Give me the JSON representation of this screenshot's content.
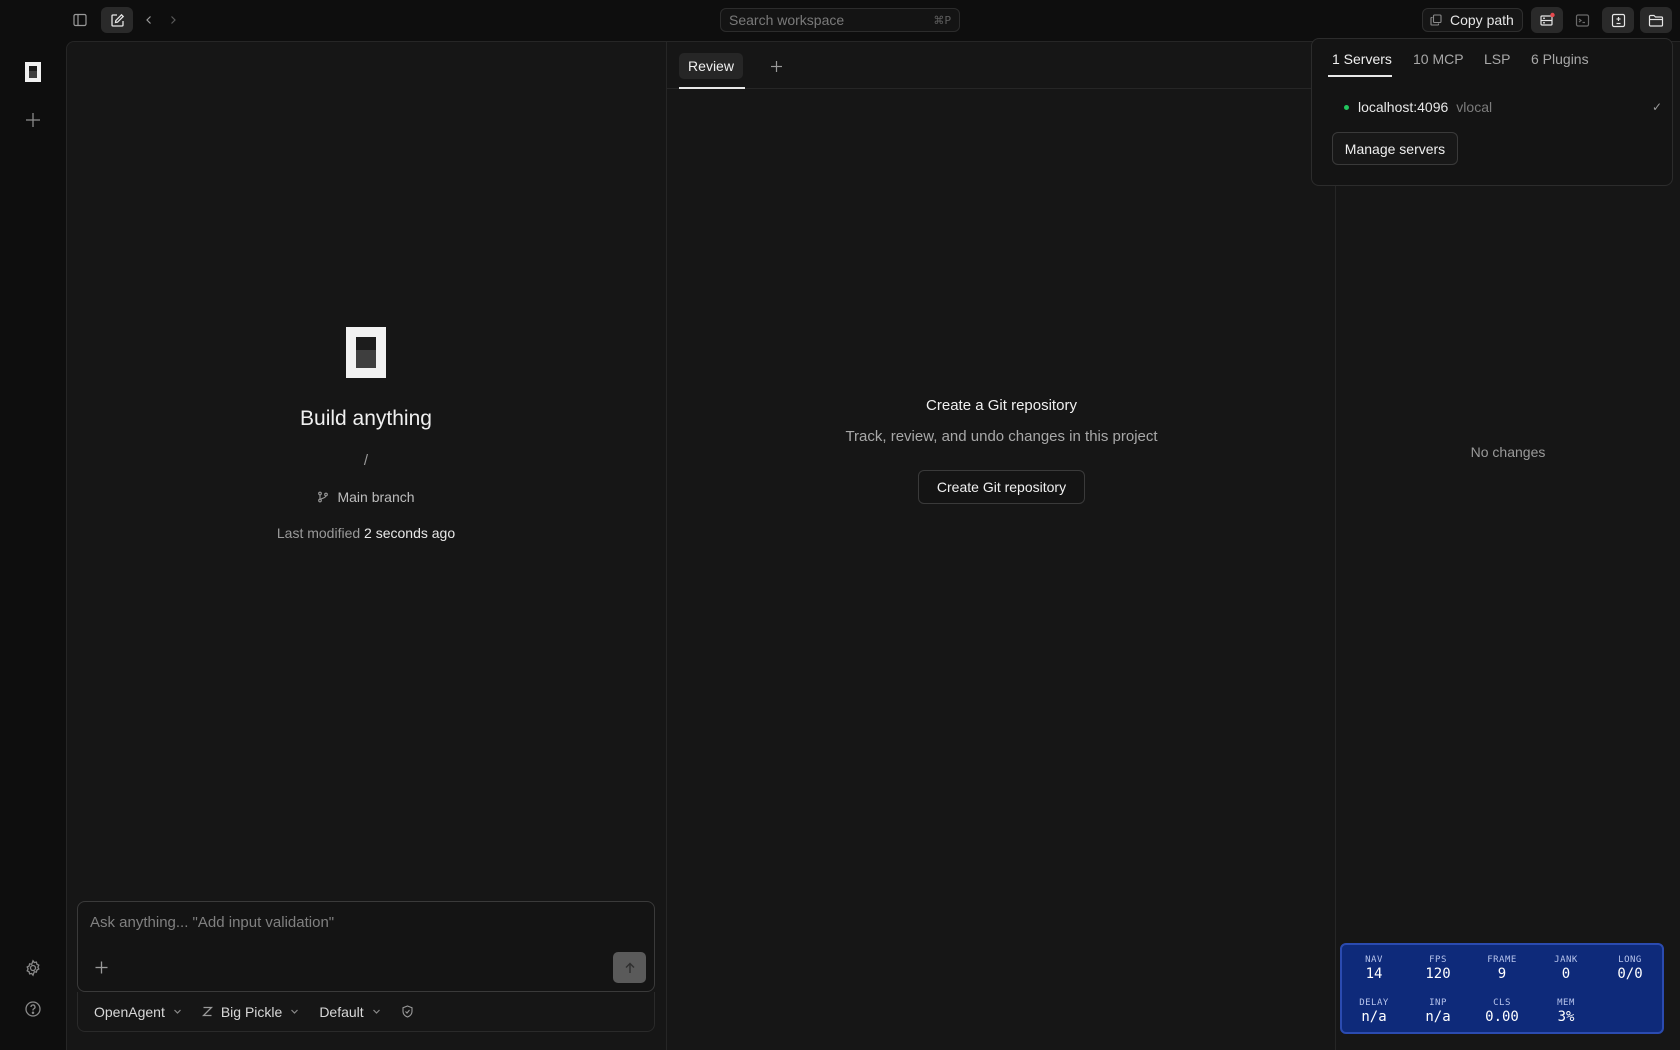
{
  "topbar": {
    "search_placeholder": "Search workspace",
    "search_shortcut": "⌘P",
    "copy_path_label": "Copy path"
  },
  "center": {
    "title": "Build anything",
    "path": "/",
    "branch": "Main branch",
    "modified_prefix": "Last modified",
    "modified_time": "2 seconds ago"
  },
  "prompt": {
    "placeholder": "Ask anything... \"Add input validation\"",
    "agent": "OpenAgent",
    "model": "Big Pickle",
    "variant": "Default"
  },
  "review": {
    "tab_label": "Review",
    "empty_title": "Create a Git repository",
    "empty_subtitle": "Track, review, and undo changes in this project",
    "create_button": "Create Git repository",
    "no_changes": "No changes"
  },
  "popover": {
    "tabs": [
      "1 Servers",
      "10 MCP",
      "LSP",
      "6 Plugins"
    ],
    "server": {
      "name": "localhost:4096",
      "version": "vlocal",
      "check": "✓",
      "status_color": "#22c55e"
    },
    "manage_button": "Manage servers"
  },
  "perf": {
    "metrics": [
      {
        "label": "NAV",
        "value": "14"
      },
      {
        "label": "FPS",
        "value": "120"
      },
      {
        "label": "FRAME",
        "value": "9"
      },
      {
        "label": "JANK",
        "value": "0"
      },
      {
        "label": "LONG",
        "value": "0/0"
      },
      {
        "label": "DELAY",
        "value": "n/a"
      },
      {
        "label": "INP",
        "value": "n/a"
      },
      {
        "label": "CLS",
        "value": "0.00"
      },
      {
        "label": "MEM",
        "value": "3%"
      }
    ]
  }
}
